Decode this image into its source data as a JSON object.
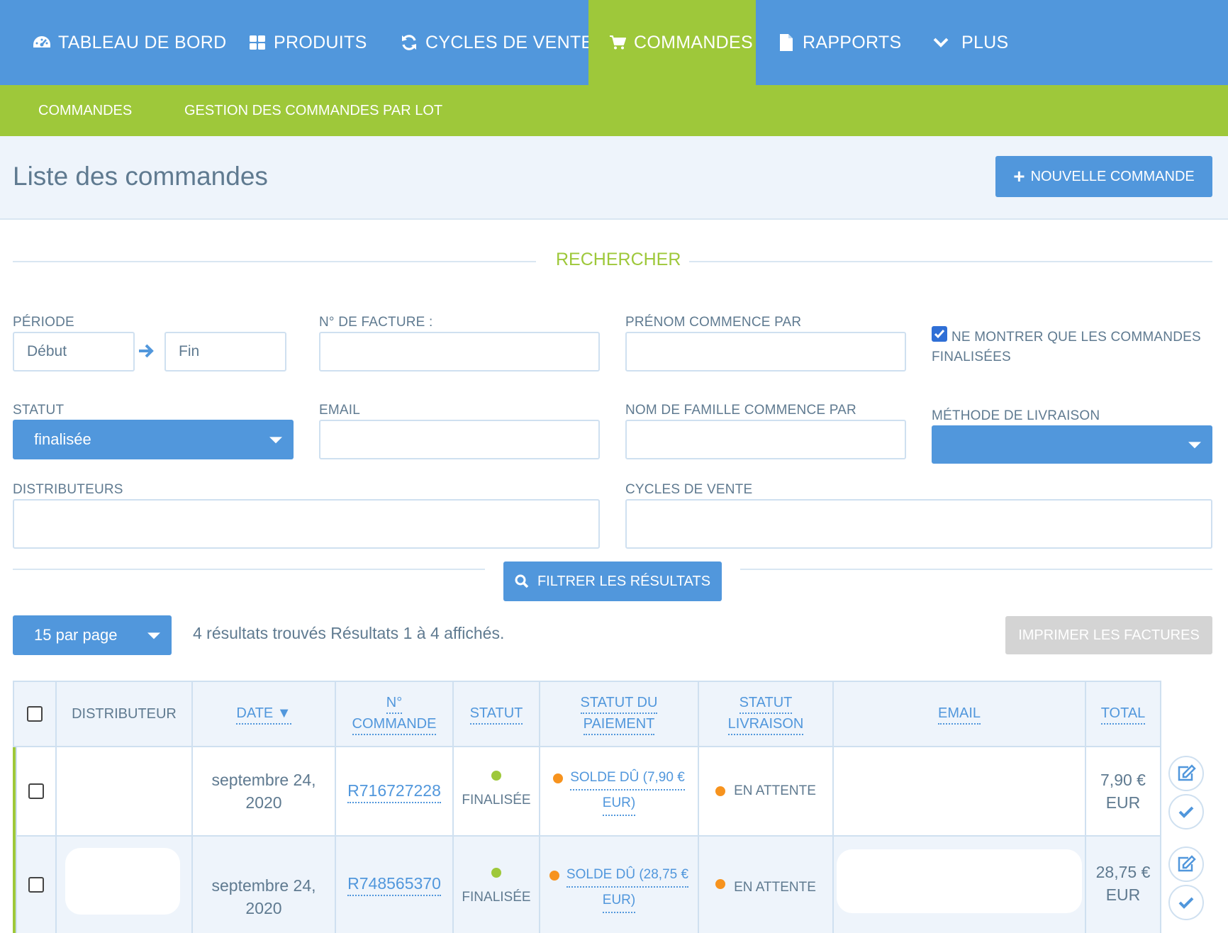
{
  "nav": {
    "items": [
      {
        "label": "TABLEAU DE BORD",
        "icon": "dashboard-icon"
      },
      {
        "label": "PRODUITS",
        "icon": "grid-icon"
      },
      {
        "label": "CYCLES DE VENTE",
        "icon": "refresh-icon"
      },
      {
        "label": "COMMANDES",
        "icon": "cart-icon",
        "active": true
      },
      {
        "label": "RAPPORTS",
        "icon": "file-icon"
      },
      {
        "label": "PLUS",
        "icon": "chevron-down-icon"
      }
    ]
  },
  "subnav": {
    "items": [
      {
        "label": "COMMANDES",
        "active": true
      },
      {
        "label": "GESTION DES COMMANDES PAR LOT"
      }
    ]
  },
  "header": {
    "title": "Liste des commandes",
    "new_order_label": "NOUVELLE COMMANDE"
  },
  "search": {
    "title": "RECHERCHER",
    "period_label": "PÉRIODE",
    "start_placeholder": "Début",
    "end_placeholder": "Fin",
    "invoice_label": "N° DE FACTURE :",
    "firstname_label": "PRÉNOM COMMENCE PAR",
    "only_finalized_label": "NE MONTRER QUE LES COMMANDES FINALISÉES",
    "only_finalized_checked": true,
    "status_label": "STATUT",
    "status_value": "finalisée",
    "email_label": "EMAIL",
    "lastname_label": "NOM DE FAMILLE COMMENCE PAR",
    "shipping_label": "MÉTHODE DE LIVRAISON",
    "shipping_value": "",
    "distributors_label": "DISTRIBUTEURS",
    "cycles_label": "CYCLES DE VENTE",
    "filter_label": "FILTRER LES RÉSULTATS"
  },
  "results": {
    "per_page": "15 par page",
    "summary": "4 résultats trouvés Résultats 1 à 4 affichés.",
    "print_label": "IMPRIMER LES FACTURES"
  },
  "table": {
    "headers": {
      "distributor": "DISTRIBUTEUR",
      "date": "DATE ▼",
      "order_no_1": "N°",
      "order_no_2": "COMMANDE",
      "status": "STATUT",
      "payment_1": "STATUT DU",
      "payment_2": "PAIEMENT",
      "shipping_1": "STATUT",
      "shipping_2": "LIVRAISON",
      "email": "EMAIL",
      "total": "TOTAL"
    },
    "rows": [
      {
        "distributor": "",
        "date_1": "septembre 24,",
        "date_2": "2020",
        "order_no": "R716727228",
        "status": "FINALISÉE",
        "payment_1": "SOLDE DÛ (7,90 €",
        "payment_2": "EUR)",
        "shipping": "EN ATTENTE",
        "email": "",
        "total_1": "7,90 €",
        "total_2": "EUR"
      },
      {
        "distributor": "",
        "date_1": "septembre 24,",
        "date_2": "2020",
        "order_no": "R748565370",
        "status": "FINALISÉE",
        "payment_1": "SOLDE DÛ (28,75 €",
        "payment_2": "EUR)",
        "shipping": "EN ATTENTE",
        "email": "",
        "total_1": "28,75 €",
        "total_2": "EUR"
      }
    ]
  },
  "colors": {
    "primary": "#5197dc",
    "accent": "#9ec83a",
    "text": "#5f7a90",
    "warning": "#f7931e"
  }
}
